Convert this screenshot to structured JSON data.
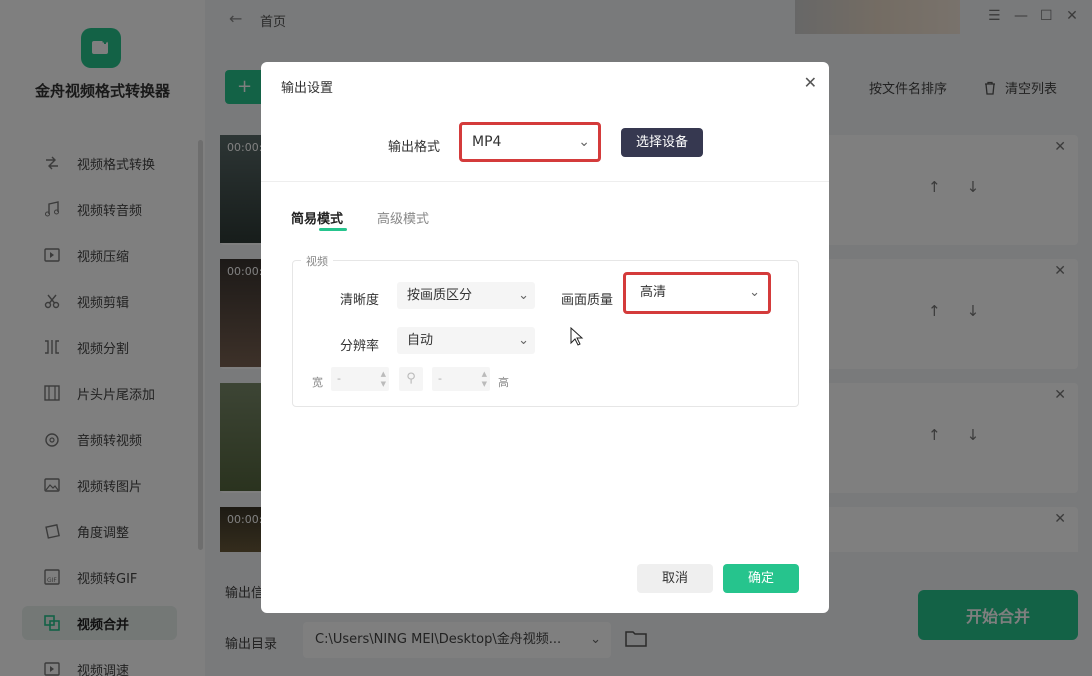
{
  "app": {
    "name": "金舟视频格式转换器",
    "breadcrumb": "首页"
  },
  "sidebar": {
    "items": [
      {
        "label": "视频格式转换",
        "icon": "convert-icon"
      },
      {
        "label": "视频转音频",
        "icon": "music-note-icon"
      },
      {
        "label": "视频压缩",
        "icon": "compress-icon"
      },
      {
        "label": "视频剪辑",
        "icon": "scissors-icon"
      },
      {
        "label": "视频分割",
        "icon": "split-icon"
      },
      {
        "label": "片头片尾添加",
        "icon": "film-strip-icon"
      },
      {
        "label": "音频转视频",
        "icon": "audio-disc-icon"
      },
      {
        "label": "视频转图片",
        "icon": "image-icon"
      },
      {
        "label": "角度调整",
        "icon": "rotate-icon"
      },
      {
        "label": "视频转GIF",
        "icon": "gif-icon"
      },
      {
        "label": "视频合并",
        "icon": "merge-icon",
        "active": true
      },
      {
        "label": "视频调速",
        "icon": "speed-icon"
      }
    ]
  },
  "toolbar": {
    "add_label": "+",
    "sort_label": "按文件名排序",
    "clear_label": "清空列表"
  },
  "file_list": {
    "items": [
      {
        "time": "00:00:"
      },
      {
        "time": "00:00:"
      },
      {
        "time": ""
      },
      {
        "time": "00:00:"
      }
    ]
  },
  "bottom": {
    "output_info_label": "输出信",
    "output_dir_label": "输出目录",
    "output_dir_value": "C:\\Users\\NING MEI\\Desktop\\金舟视频...",
    "start_label": "开始合并"
  },
  "dialog": {
    "title": "输出设置",
    "format_label": "输出格式",
    "format_value": "MP4",
    "device_button": "选择设备",
    "tabs": {
      "simple": "简易模式",
      "advanced": "高级模式"
    },
    "video_section": "视频",
    "clarity_label": "清晰度",
    "clarity_value": "按画质区分",
    "quality_label": "画面质量",
    "quality_value": "高清",
    "resolution_label": "分辨率",
    "resolution_value": "自动",
    "width_label": "宽",
    "height_label": "高",
    "width_value": "-",
    "height_value": "-",
    "cancel": "取消",
    "confirm": "确定"
  },
  "colors": {
    "accent": "#26c48d",
    "highlight_border": "#d43b3b",
    "device_button_bg": "#363850"
  }
}
